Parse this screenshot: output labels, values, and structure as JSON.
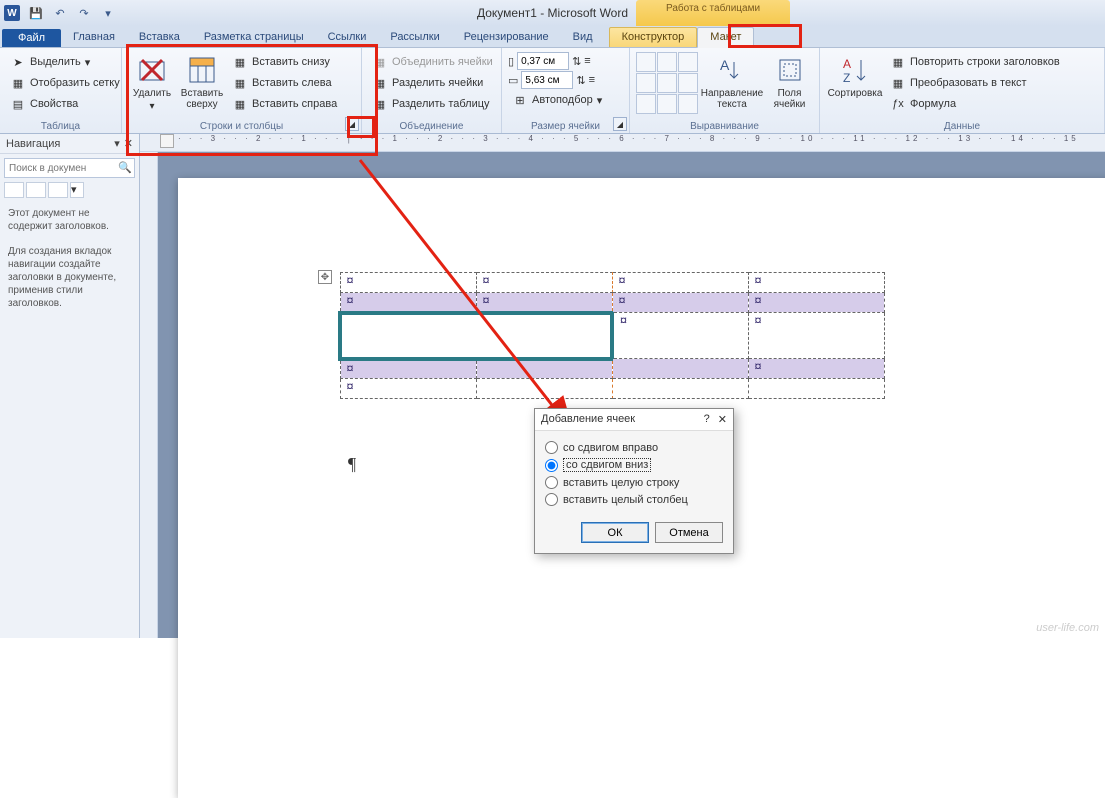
{
  "titlebar": {
    "app_letter": "W",
    "doc_title": "Документ1 - Microsoft Word",
    "table_tools": "Работа с таблицами"
  },
  "tabs": {
    "file": "Файл",
    "home": "Главная",
    "insert": "Вставка",
    "page_layout": "Разметка страницы",
    "references": "Ссылки",
    "mailings": "Рассылки",
    "review": "Рецензирование",
    "view": "Вид",
    "design": "Конструктор",
    "layout": "Макет"
  },
  "ribbon": {
    "table": {
      "title": "Таблица",
      "select": "Выделить",
      "gridlines": "Отобразить сетку",
      "properties": "Свойства"
    },
    "rows_cols": {
      "title": "Строки и столбцы",
      "delete": "Удалить",
      "insert_above": "Вставить сверху",
      "insert_below": "Вставить снизу",
      "insert_left": "Вставить слева",
      "insert_right": "Вставить справа"
    },
    "merge": {
      "title": "Объединение",
      "merge_cells": "Объединить ячейки",
      "split_cells": "Разделить ячейки",
      "split_table": "Разделить таблицу"
    },
    "cell_size": {
      "title": "Размер ячейки",
      "height": "0,37 см",
      "width": "5,63 см",
      "autofit": "Автоподбор"
    },
    "alignment": {
      "title": "Выравнивание",
      "text_direction": "Направление текста",
      "cell_margins": "Поля ячейки"
    },
    "data": {
      "title": "Данные",
      "sort": "Сортировка",
      "repeat_headers": "Повторить строки заголовков",
      "convert": "Преобразовать в текст",
      "formula": "Формула"
    }
  },
  "nav": {
    "title": "Навигация",
    "search_placeholder": "Поиск в докумен",
    "text1": "Этот документ не содержит заголовков.",
    "text2": "Для создания вкладок навигации создайте заголовки в документе, применив стили заголовков."
  },
  "dialog": {
    "title": "Добавление ячеек",
    "help": "?",
    "close": "✕",
    "opt_shift_right": "со сдвигом вправо",
    "opt_shift_down": "со сдвигом вниз",
    "opt_entire_row": "вставить целую строку",
    "opt_entire_col": "вставить целый столбец",
    "ok": "ОК",
    "cancel": "Отмена"
  },
  "ruler_marks": "· · · 3 · · · 2 · · · 1 · · · │ · · · 1 · · · 2 · · · 3 · · · 4 · · · 5 · · · 6 · · · 7 · · · 8 · · · 9 · · · 10 · · · 11 · · · 12 · · · 13 · · · 14 · · · 15",
  "cell_mark": "¤",
  "pilcrow": "¶",
  "move_handle": "✥",
  "watermark": "user-life.com"
}
